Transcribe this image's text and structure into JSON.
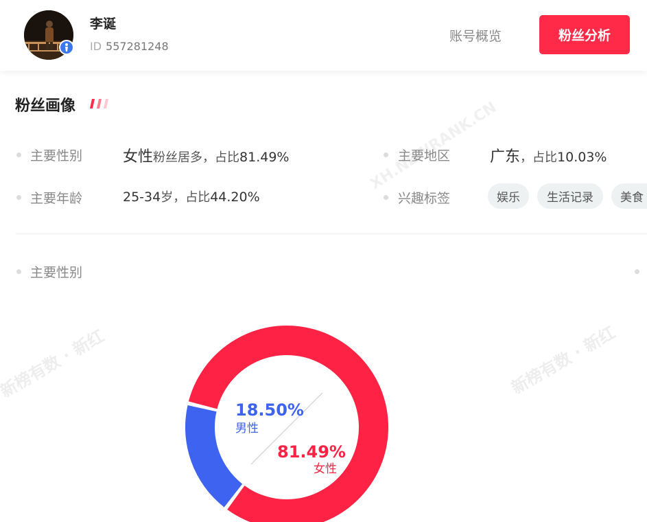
{
  "account": {
    "name": "李诞",
    "id_label": "ID",
    "id_value": "557281248",
    "verified_icon": "verified-badge-icon"
  },
  "nav": {
    "overview_label": "账号概览",
    "fans_label": "粉丝分析",
    "active": "粉丝分析"
  },
  "portrait": {
    "title": "粉丝画像",
    "gender": {
      "label": "主要性别",
      "main": "女性",
      "suffix": "粉丝居多，占比",
      "percent": "81.49%"
    },
    "region": {
      "label": "主要地区",
      "main": "广东",
      "suffix": "，占比",
      "percent": "10.03%"
    },
    "age": {
      "label": "主要年龄",
      "main": "25-34",
      "suffix": "岁，占比",
      "percent": "44.20%"
    },
    "interests": {
      "label": "兴趣标签",
      "tags": [
        "娱乐",
        "生活记录",
        "美食"
      ]
    }
  },
  "gender_chart": {
    "label": "主要性别"
  },
  "watermarks": {
    "top": "XH.NEWRANK.CN",
    "left": "新榜有数 · 新红",
    "right": "新榜有数 · 新红"
  },
  "colors": {
    "accent": "#fe2a47",
    "male": "#3d63f0",
    "female": "#fe2245",
    "verified": "#3b78f0"
  },
  "chart_data": {
    "type": "pie",
    "categories": [
      "男性",
      "女性"
    ],
    "values": [
      18.5,
      81.49
    ],
    "labels": [
      "18.50%",
      "81.49%"
    ],
    "colors": [
      "#3d63f0",
      "#fe2245"
    ],
    "donut": true
  }
}
